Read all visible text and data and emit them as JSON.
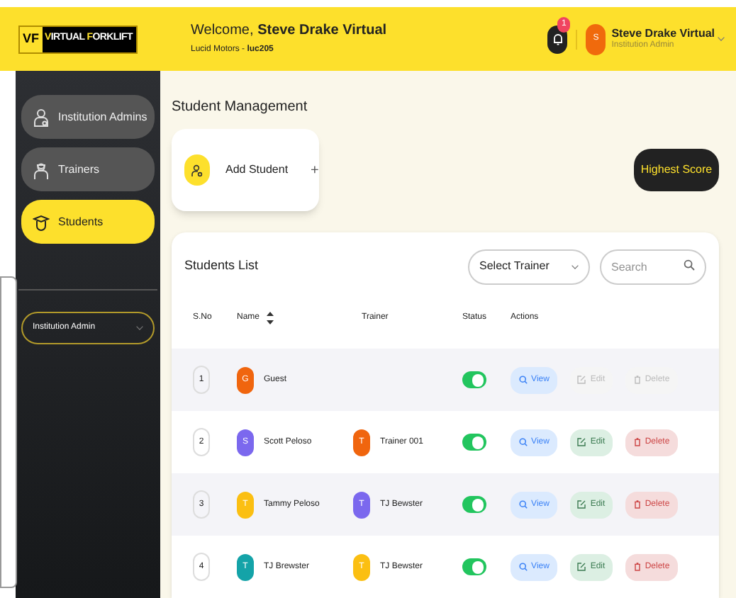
{
  "header": {
    "logo": {
      "mark": "VF",
      "brand_first": "V",
      "brand_rest_1": "IRTUAL ",
      "brand_f": "F",
      "brand_rest_2": "ORKLIFT"
    },
    "welcome_prefix": "Welcome,",
    "welcome_name": "Steve Drake Virtual",
    "org": "Lucid Motors - ",
    "org_code": "luc205",
    "notifications": "1",
    "user": {
      "initial": "S",
      "name": "Steve Drake Virtual",
      "role": "Institution Admin"
    }
  },
  "sidebar": {
    "items": [
      {
        "label": "Institution Admins",
        "selected": false
      },
      {
        "label": "Trainers",
        "selected": false
      },
      {
        "label": "Students",
        "selected": true
      }
    ],
    "role_select": "Institution Admin"
  },
  "page_title": "Student Management",
  "add_card": {
    "label": "Add Student",
    "plus": "+"
  },
  "highest_score": "Highest Score",
  "list": {
    "title": "Students List",
    "trainer_select": "Select Trainer",
    "search_placeholder": "Search",
    "columns": [
      "S.No",
      "Name",
      "Trainer",
      "Status",
      "Actions"
    ],
    "rows": [
      {
        "no": "1",
        "initial": "G",
        "color": "#f0650e",
        "name": "Guest",
        "on": true,
        "editable": false,
        "actions": {
          "view": "View",
          "edit": "Edit",
          "delete": "Delete"
        }
      },
      {
        "no": "2",
        "initial": "S",
        "color": "#7b68ee",
        "name": "Scott Peloso",
        "trainer": {
          "initial": "T",
          "color": "#f0650e",
          "name": "Trainer 001"
        },
        "on": true,
        "editable": true,
        "actions": {
          "view": "View",
          "edit": "Edit",
          "delete": "Delete"
        }
      },
      {
        "no": "3",
        "initial": "T",
        "color": "#fbbf12",
        "name": "Tammy Peloso",
        "trainer": {
          "initial": "T",
          "color": "#7b68ee",
          "name": "TJ Bewster"
        },
        "on": true,
        "editable": true,
        "actions": {
          "view": "View",
          "edit": "Edit",
          "delete": "Delete"
        }
      },
      {
        "no": "4",
        "initial": "T",
        "color": "#14a3a8",
        "name": "TJ Brewster",
        "trainer": {
          "initial": "T",
          "color": "#fbbf12",
          "name": "TJ Bewster"
        },
        "on": true,
        "editable": true,
        "actions": {
          "view": "View",
          "edit": "Edit",
          "delete": "Delete"
        }
      }
    ]
  }
}
